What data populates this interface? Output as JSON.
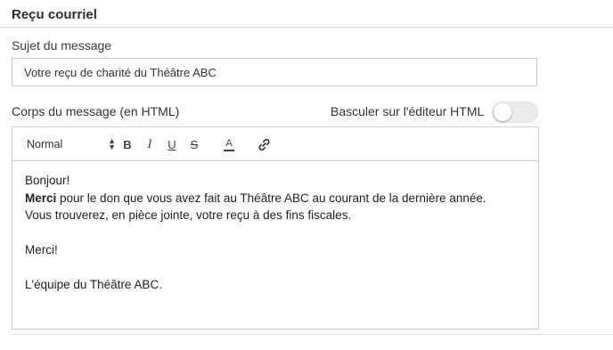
{
  "section": {
    "title": "Reçu courriel"
  },
  "subject": {
    "label": "Sujet du message",
    "value": "Votre reçu de charité du Théâtre ABC"
  },
  "body": {
    "label": "Corps du message (en HTML)",
    "toggle_label": "Basculer sur l'éditeur HTML",
    "toggle_on": false
  },
  "toolbar": {
    "format_value": "Normal",
    "bold": "B",
    "italic": "I",
    "underline": "U",
    "strike": "S",
    "color": "A"
  },
  "editor_content": {
    "line1": "Bonjour!",
    "line2_bold": "Merci",
    "line2_rest": " pour le don que vous avez fait au Théâtre ABC au courant de la dernière année.",
    "line3": "Vous trouverez, en pièce jointe, votre reçu à des fins fiscales.",
    "line4": "Merci!",
    "line5": "L'équipe du Théâtre ABC."
  },
  "colors": {
    "rule": "#dedede",
    "border": "#cfcfcf",
    "toggle_track": "#ebebeb"
  }
}
